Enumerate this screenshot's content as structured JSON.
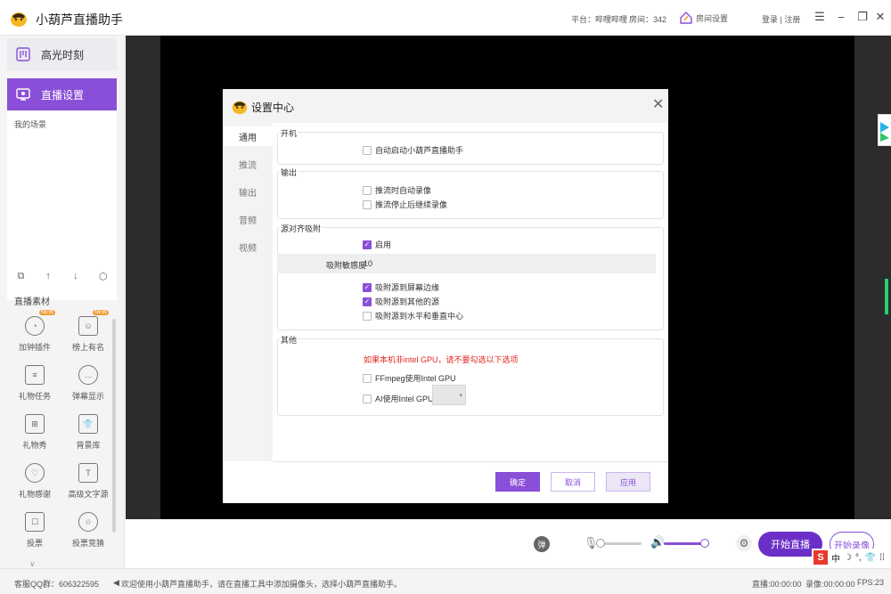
{
  "app": {
    "title": "小葫芦直播助手",
    "platform": "平台：哔哩哔哩",
    "room": "房间：342",
    "room_settings": "房间设置",
    "login": "登录 | 注册"
  },
  "sidebar": {
    "highlight_label": "高光时刻",
    "live_settings_label": "直播设置",
    "my_scenes": "我的场景",
    "materials_label": "直播素材",
    "materials": [
      {
        "label": "加钟插件",
        "badge": "NEW"
      },
      {
        "label": "榜上有名",
        "badge": "NEW"
      },
      {
        "label": "礼物任务"
      },
      {
        "label": "弹幕显示"
      },
      {
        "label": "礼物秀"
      },
      {
        "label": "背景库"
      },
      {
        "label": "礼物感谢"
      },
      {
        "label": "高级文字源"
      },
      {
        "label": "投票"
      },
      {
        "label": "投票竞猜"
      }
    ]
  },
  "controls": {
    "danmu": "弹",
    "start_live": "开始直播",
    "start_record": "开始录像",
    "mic_level": 0,
    "speaker_level": 1.0
  },
  "ime": {
    "logo": "S",
    "mode": "中"
  },
  "statusbar": {
    "qq": "客服QQ群：606322595",
    "notice": "欢迎使用小葫芦直播助手，请在直播工具中添加摄像头，选择小葫芦直播助手。",
    "live_time": "直播:00:00:00",
    "record_time": "录像:00:00:00",
    "fps": "FPS:23"
  },
  "dialog": {
    "title": "设置中心",
    "nav": [
      "通用",
      "推流",
      "输出",
      "音频",
      "视频"
    ],
    "sections": {
      "startup": {
        "title": "开机",
        "auto_start": "自动启动小葫芦直播助手"
      },
      "output": {
        "title": "输出",
        "auto_record": "推流时自动录像",
        "continue_record": "推流停止后继续录像"
      },
      "snap": {
        "title": "源对齐吸附",
        "enable": "启用",
        "sensitivity_label": "吸附敏感度",
        "sensitivity_value": "10",
        "to_screen_edge": "吸附源到屏幕边缘",
        "to_other_sources": "吸附源到其他的源",
        "to_center": "吸附源到水平和垂直中心"
      },
      "other": {
        "title": "其他",
        "warning": "如果本机非intel GPU，请不要勾选以下选项",
        "ffmpeg_gpu": "FFmpeg使用Intel GPU",
        "ai_gpu": "AI使用Intel GPU"
      }
    },
    "buttons": {
      "ok": "确定",
      "cancel": "取消",
      "apply": "应用"
    }
  },
  "colors": {
    "accent": "#8a4fd8",
    "start_live": "#6b2fc7",
    "warning": "#e0281f"
  }
}
